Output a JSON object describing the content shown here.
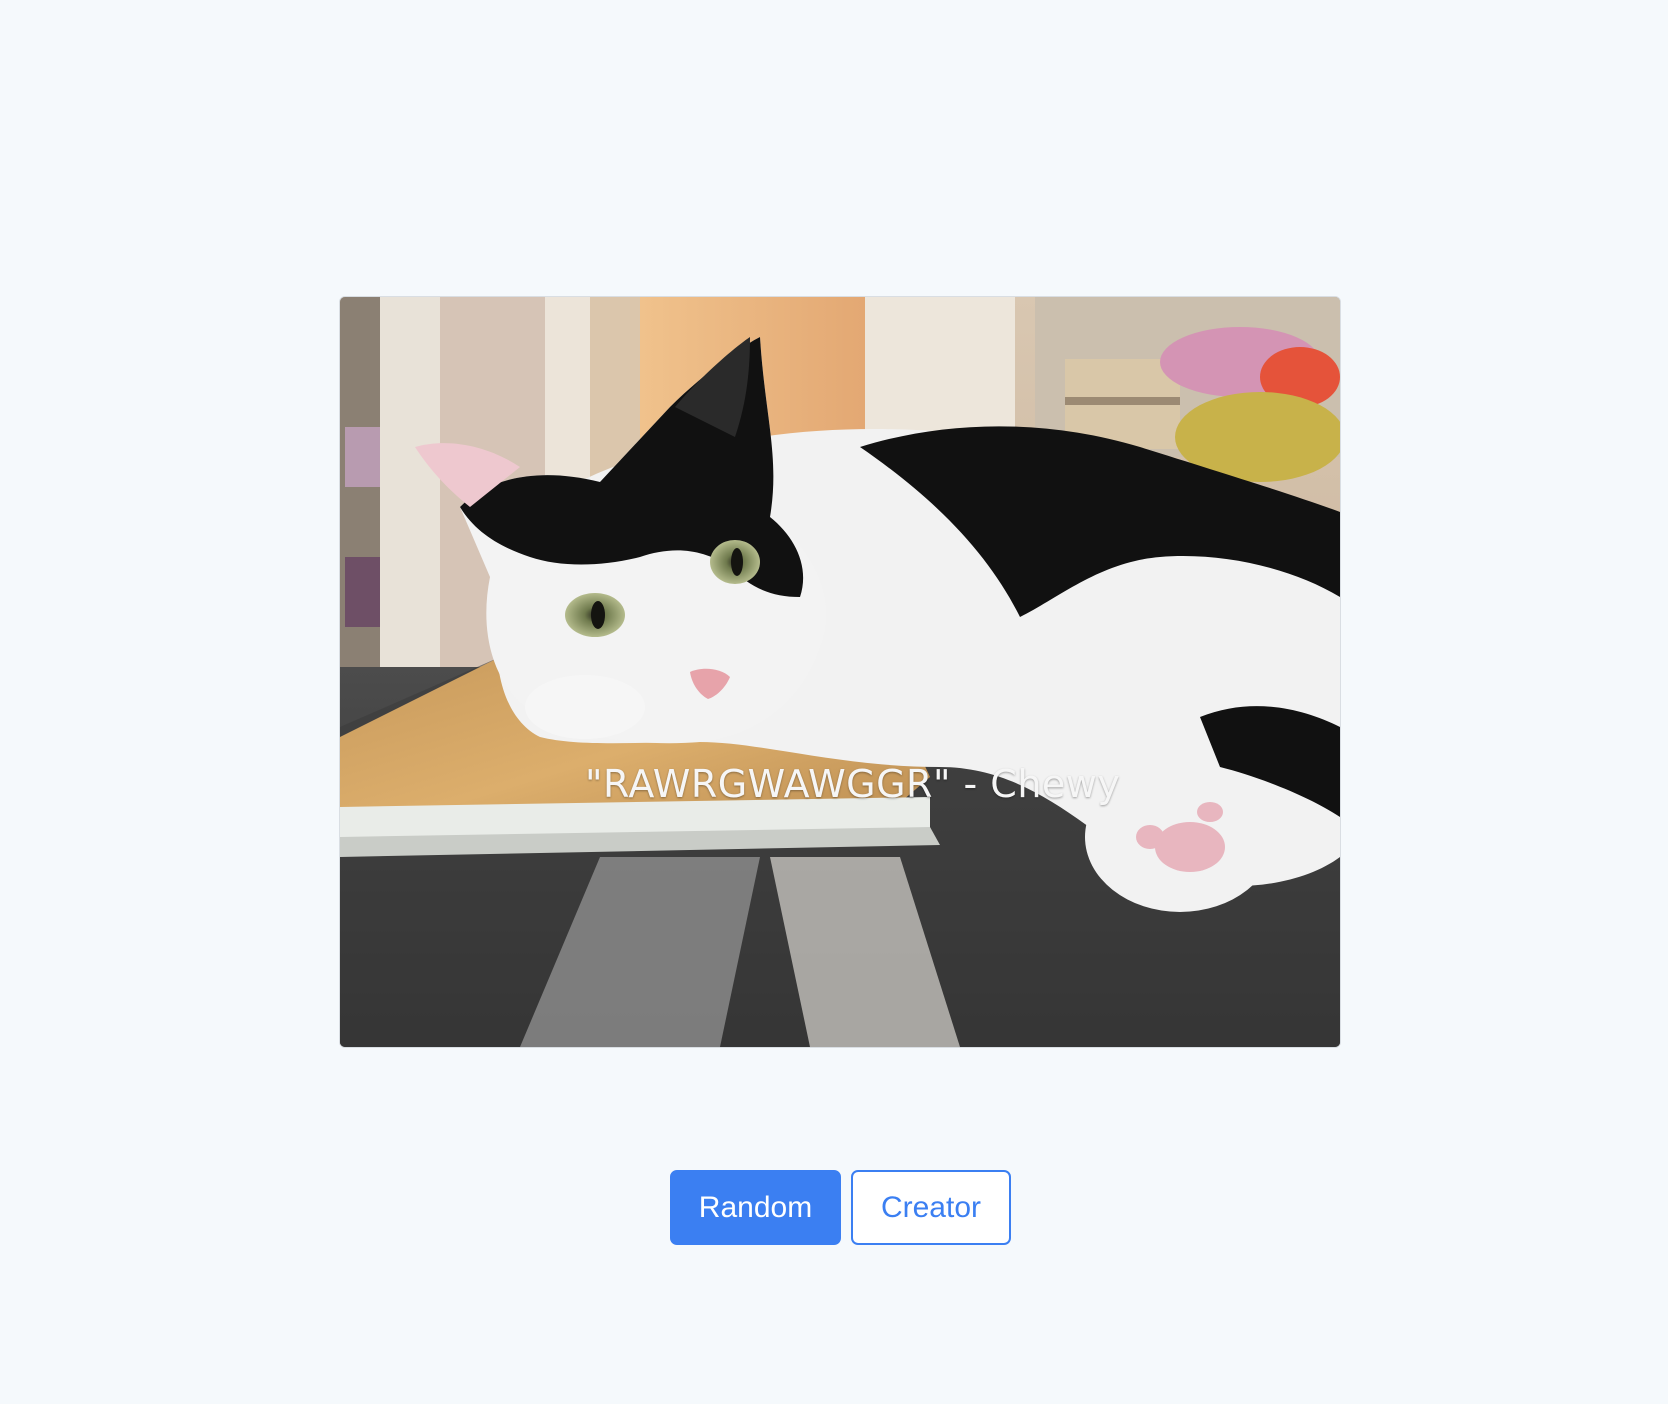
{
  "card": {
    "image_label": "cat-photo",
    "caption": "\"RAWRGWAWGGR\" - Chewy"
  },
  "actions": {
    "random_label": "Random",
    "creator_label": "Creator"
  },
  "colors": {
    "page_background": "#f5f9fc",
    "primary": "#3b7ff2",
    "button_text_light": "#ffffff"
  }
}
